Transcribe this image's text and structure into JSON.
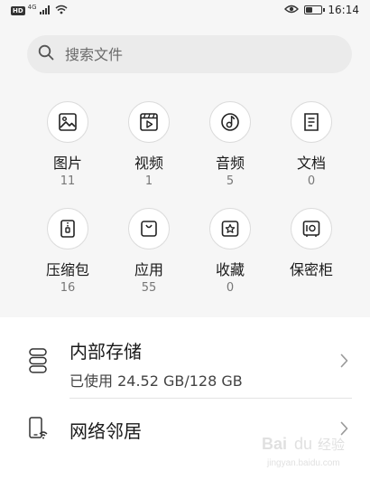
{
  "status_bar": {
    "hd": "HD",
    "network": "4G",
    "time": "16:14",
    "battery_level": 0.45
  },
  "search": {
    "placeholder": "搜索文件",
    "icon": "search-icon"
  },
  "categories": [
    {
      "label": "图片",
      "count": "11",
      "icon": "image-icon"
    },
    {
      "label": "视频",
      "count": "1",
      "icon": "video-icon"
    },
    {
      "label": "音频",
      "count": "5",
      "icon": "audio-icon"
    },
    {
      "label": "文档",
      "count": "0",
      "icon": "document-icon"
    },
    {
      "label": "压缩包",
      "count": "16",
      "icon": "archive-icon"
    },
    {
      "label": "应用",
      "count": "55",
      "icon": "app-bag-icon"
    },
    {
      "label": "收藏",
      "count": "0",
      "icon": "favorite-star-icon"
    },
    {
      "label": "保密柜",
      "count": "",
      "icon": "safe-icon"
    }
  ],
  "storage": {
    "title": "内部存储",
    "usage": "已使用 24.52 GB/128 GB",
    "icon": "storage-icon"
  },
  "network_neighbor": {
    "title": "网络邻居",
    "icon": "network-device-icon"
  },
  "watermark": "Baidu 经验 jingyan.baidu.com",
  "colors": {
    "background": "#f6f6f6",
    "card": "#ffffff",
    "icon_stroke": "#222222"
  }
}
